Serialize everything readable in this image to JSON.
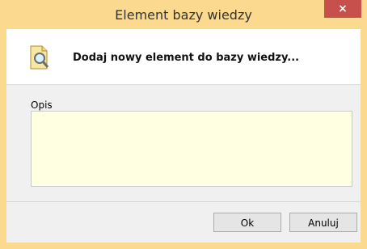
{
  "window": {
    "title": "Element bazy wiedzy",
    "close_glyph": "×"
  },
  "header": {
    "icon": "document-search-icon",
    "text": "Dodaj nowy element do bazy wiedzy..."
  },
  "form": {
    "description_label": "Opis",
    "description_value": ""
  },
  "buttons": {
    "ok_label": "Ok",
    "cancel_label": "Anuluj"
  },
  "colors": {
    "frame": "#fbd98f",
    "close": "#c7504c",
    "textarea_bg": "#ffffe1"
  }
}
